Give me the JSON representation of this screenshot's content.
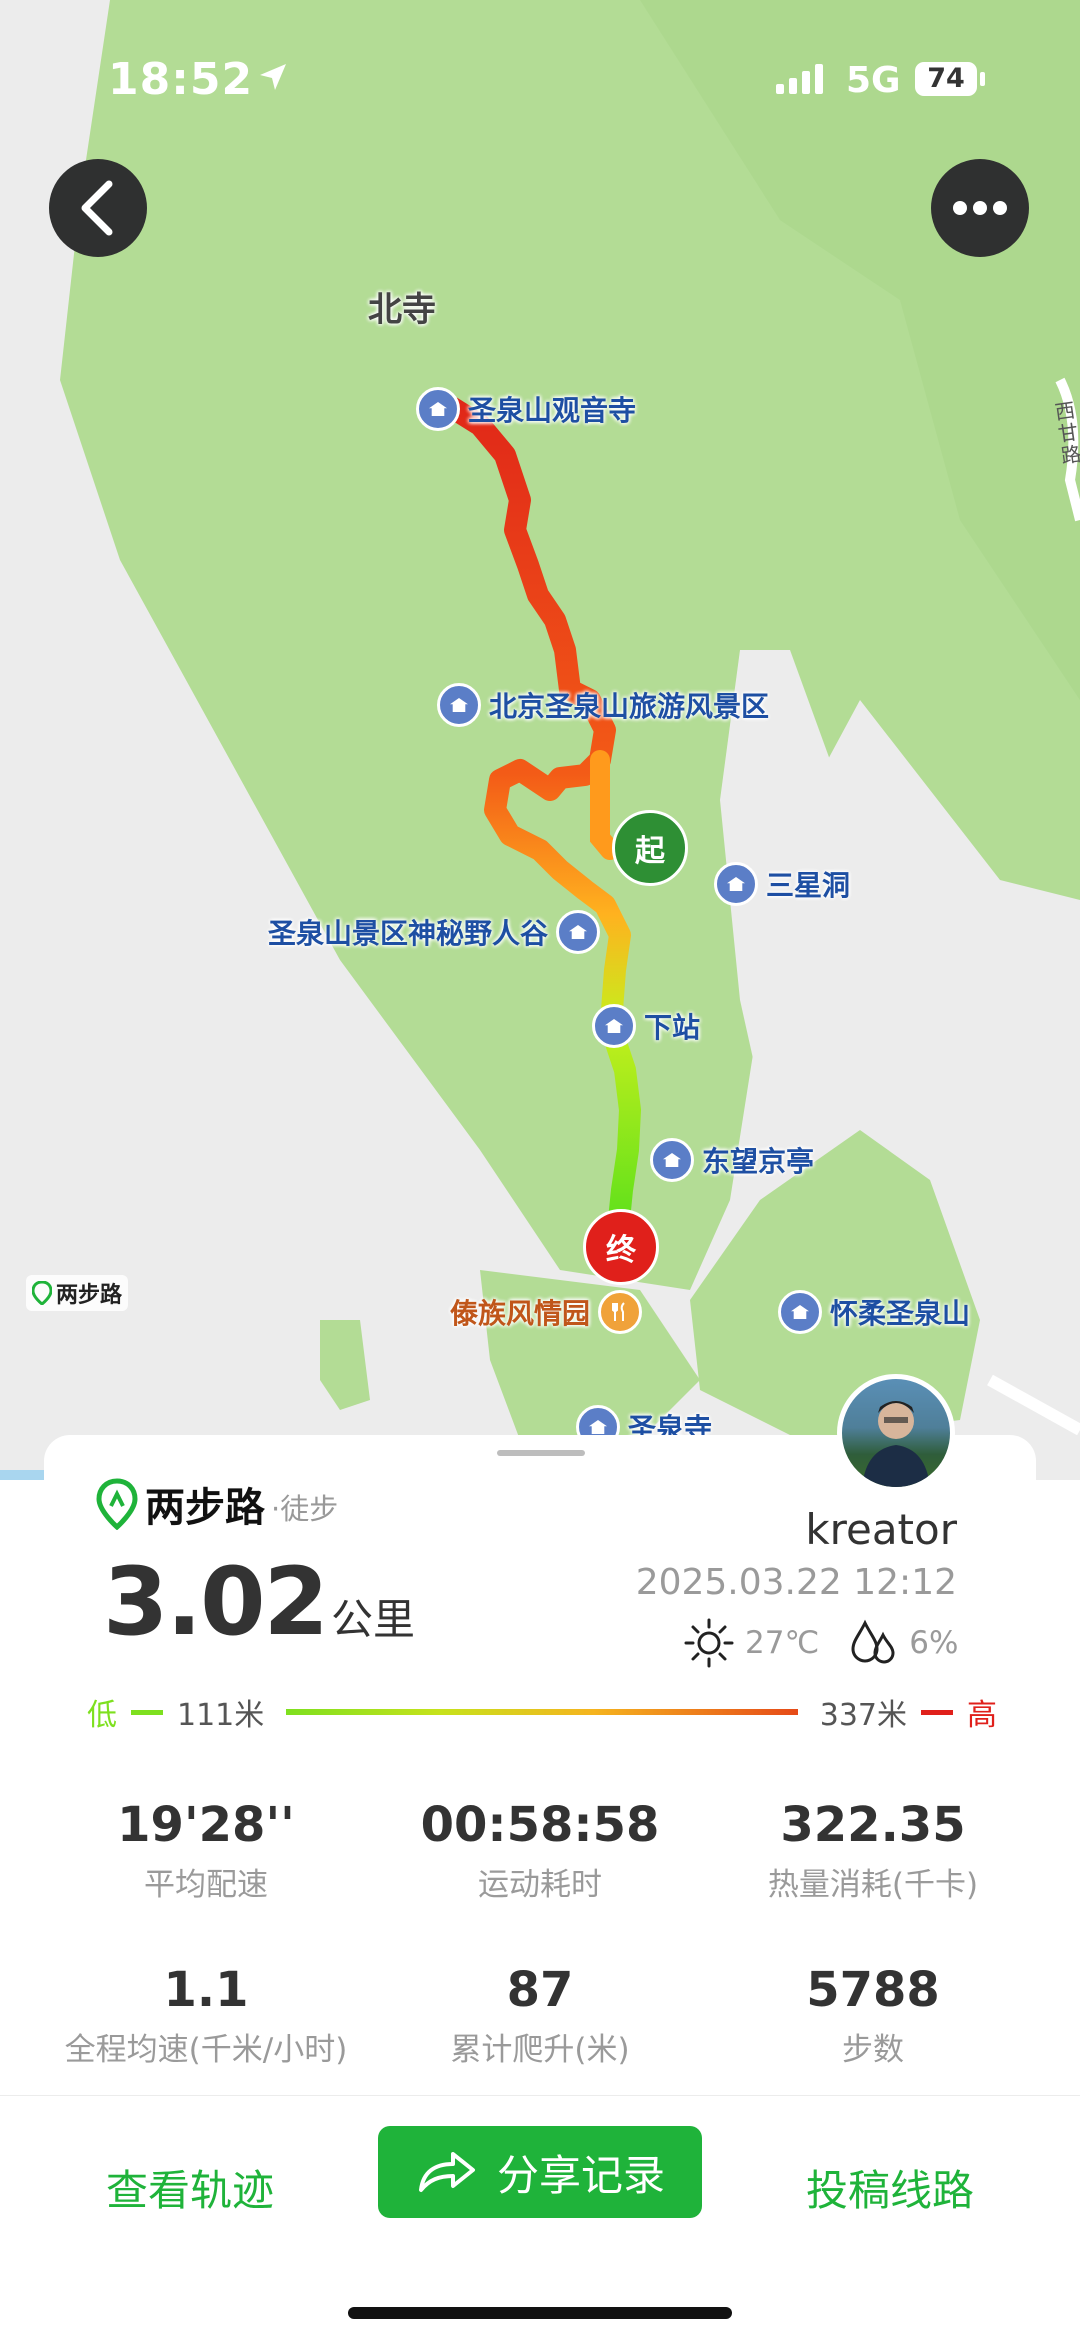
{
  "status_bar": {
    "time": "18:52",
    "network": "5G",
    "battery": "74"
  },
  "map": {
    "logo": "两步路",
    "place_labels": {
      "bei_si": "北寺",
      "guanyin": "圣泉山观音寺",
      "scenic_area": "北京圣泉山旅游风景区",
      "sanxing": "三星洞",
      "yeren": "圣泉山景区神秘野人谷",
      "xiazhan": "下站",
      "dongwang": "东望京亭",
      "daizu": "傣族风情园",
      "huairou": "怀柔圣泉山",
      "shengquan": "圣泉寺",
      "road": "西甘路"
    },
    "start_marker": "起",
    "end_marker": "终",
    "colors": {
      "land": "#b3dc95",
      "land_dark": "#9fd07e",
      "bg": "#ececec",
      "poi": "#5b7ec7",
      "restaurant": "#f0a23a"
    }
  },
  "card": {
    "brand": "两步路",
    "activity": "·徒步",
    "distance": "3.02",
    "distance_unit": "公里",
    "username": "kreator",
    "datetime": "2025.03.22 12:12",
    "temperature": "27℃",
    "humidity": "6%",
    "elevation": {
      "low_label": "低",
      "low_value": "111米",
      "high_value": "337米",
      "high_label": "高"
    },
    "stats": [
      {
        "value": "19'28''",
        "label": "平均配速"
      },
      {
        "value": "00:58:58",
        "label": "运动耗时"
      },
      {
        "value": "322.35",
        "label": "热量消耗(千卡)"
      },
      {
        "value": "1.1",
        "label": "全程均速(千米/小时)"
      },
      {
        "value": "87",
        "label": "累计爬升(米)"
      },
      {
        "value": "5788",
        "label": "步数"
      }
    ]
  },
  "actions": {
    "view_track": "查看轨迹",
    "share": "分享记录",
    "submit_route": "投稿线路"
  },
  "colors": {
    "green": "#1fb33a",
    "low": "#7ee01f",
    "high": "#e0201b"
  }
}
